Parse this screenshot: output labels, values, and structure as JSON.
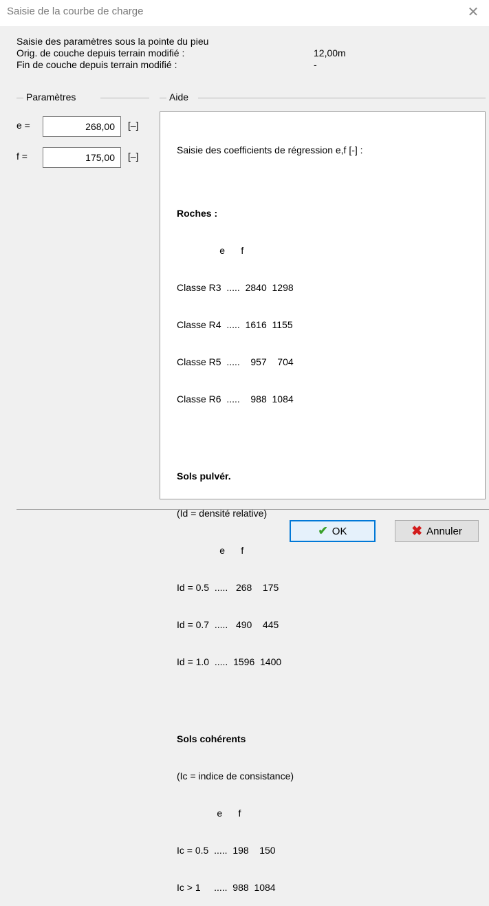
{
  "window": {
    "title": "Saisie de la courbe de charge",
    "close_glyph": "✕"
  },
  "info": {
    "heading": "Saisie des paramètres sous la pointe du pieu",
    "orig_label": "Orig. de couche depuis terrain modifié :",
    "orig_value": "12,00m",
    "fin_label": "Fin de couche depuis terrain modifié :",
    "fin_value": "-"
  },
  "params": {
    "group_title": "Paramètres",
    "e_label": "e =",
    "e_value": "268,00",
    "e_unit": "[–]",
    "f_label": "f =",
    "f_value": "175,00",
    "f_unit": "[–]"
  },
  "aide": {
    "group_title": "Aide",
    "intro": "Saisie des coefficients de régression e,f [-] :",
    "sections": [
      {
        "title": "Roches :",
        "lines": [
          "                e      f",
          "Classe R3  .....  2840  1298",
          "Classe R4  .....  1616  1155",
          "Classe R5  .....    957    704",
          "Classe R6  .....    988  1084"
        ]
      },
      {
        "title": "Sols pulvér.",
        "lines": [
          "(Id = densité relative)",
          "                e      f",
          "Id = 0.5  .....   268    175",
          "Id = 0.7  .....   490    445",
          "Id = 1.0  .....  1596  1400"
        ]
      },
      {
        "title": "Sols cohérents",
        "lines": [
          "(Ic = indice de consistance)",
          "               e      f",
          "Ic = 0.5  .....  198    150",
          "Ic > 1     .....  988  1084"
        ]
      }
    ]
  },
  "buttons": {
    "ok_label": "OK",
    "ok_icon": "✔",
    "cancel_label": "Annuler",
    "cancel_icon": "✖"
  },
  "colors": {
    "ok_border": "#0078d7",
    "check_green": "#3aa02a",
    "cancel_red": "#d21c1c"
  }
}
